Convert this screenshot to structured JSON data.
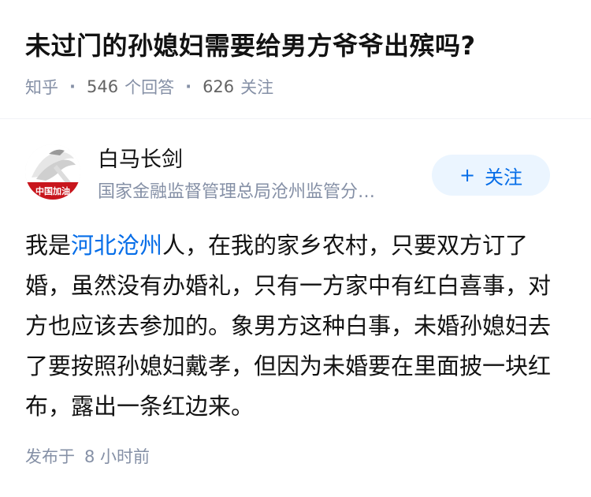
{
  "question": {
    "title": "未过门的孙媳妇需要给男方爷爷出殡吗?",
    "source": "知乎",
    "answer_count": "546",
    "answer_label": "个回答",
    "follower_count": "626",
    "follower_label": "关注"
  },
  "author": {
    "avatar_text": "中国加油",
    "name": "白马长剑",
    "headline": "国家金融监督管理总局沧州监管分…",
    "follow_label": "关注",
    "follow_icon": "plus-icon"
  },
  "answer": {
    "text_before_link": "我是",
    "link_text": "河北沧州",
    "text_after_link": "人，在我的家乡农村，只要双方订了婚，虽然没有办婚礼，只有一方家中有红白喜事，对方也应该去参加的。象男方这种白事，未婚孙媳妇去了要按照孙媳妇戴孝，但因为未婚要在里面披一块红布，露出一条红边来。",
    "published_label": "发布于",
    "published_time": "8 小时前"
  },
  "colors": {
    "link": "#056de8",
    "meta": "#8590a6",
    "follow_bg": "#ebf5ff",
    "avatar_red": "#c8161d"
  }
}
